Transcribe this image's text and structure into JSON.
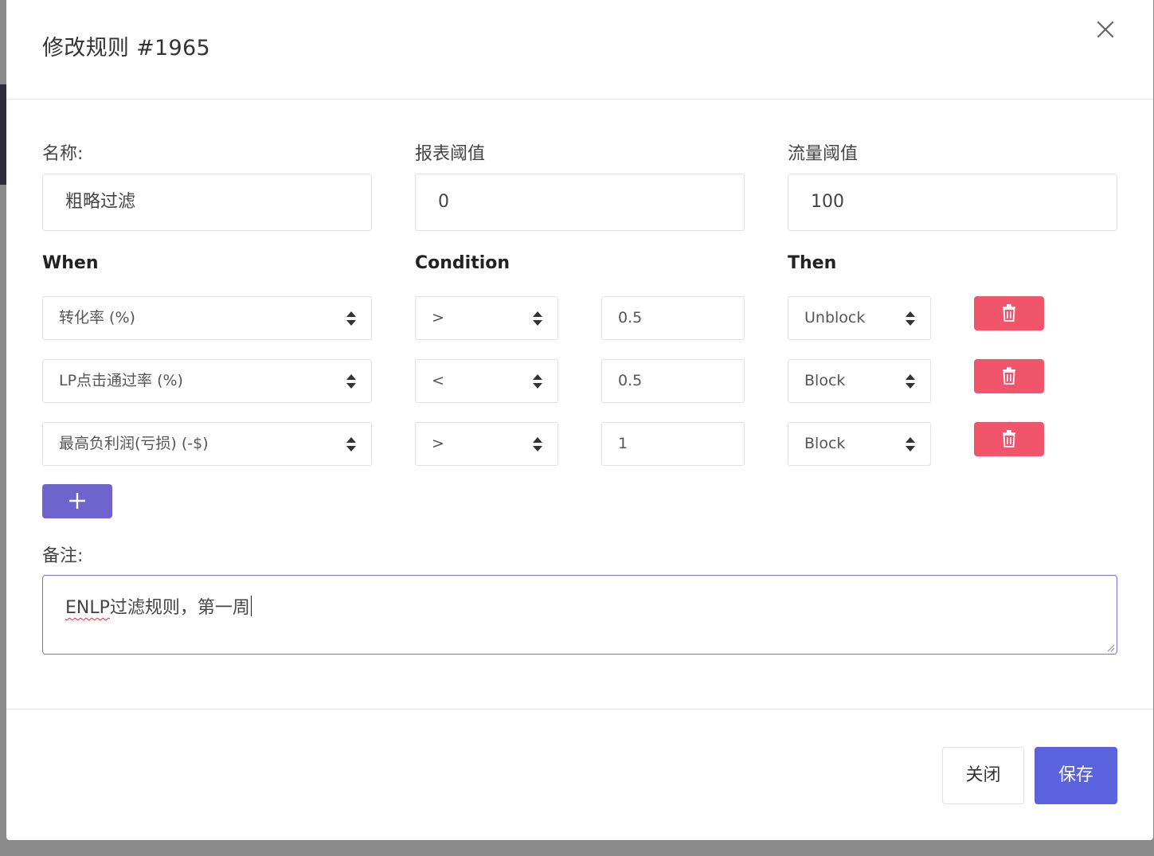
{
  "modal": {
    "title": "修改规则 #1965"
  },
  "fields": {
    "name_label": "名称:",
    "name_value": "粗略过滤",
    "report_threshold_label": "报表阈值",
    "report_threshold_value": "0",
    "traffic_threshold_label": "流量阈值",
    "traffic_threshold_value": "100"
  },
  "headers": {
    "when": "When",
    "condition": "Condition",
    "then": "Then"
  },
  "rules": [
    {
      "when": "转化率 (%)",
      "operator": ">",
      "value": "0.5",
      "then": "Unblock"
    },
    {
      "when": "LP点击通过率 (%)",
      "operator": "<",
      "value": "0.5",
      "then": "Block"
    },
    {
      "when": "最高负利润(亏损) (-$)",
      "operator": ">",
      "value": "1",
      "then": "Block"
    }
  ],
  "notes": {
    "label": "备注:",
    "value_prefix": "ENLP",
    "value_rest": "过滤规则，第一周"
  },
  "footer": {
    "close_label": "关闭",
    "save_label": "保存"
  },
  "colors": {
    "delete_button": "#f1556c",
    "add_button": "#6e64cc",
    "save_button": "#5b62de",
    "focus_border": "#7a70cf"
  },
  "icons": {
    "close": "close-icon",
    "delete": "trash-icon",
    "add": "plus-icon",
    "select": "sort-arrows-icon"
  }
}
